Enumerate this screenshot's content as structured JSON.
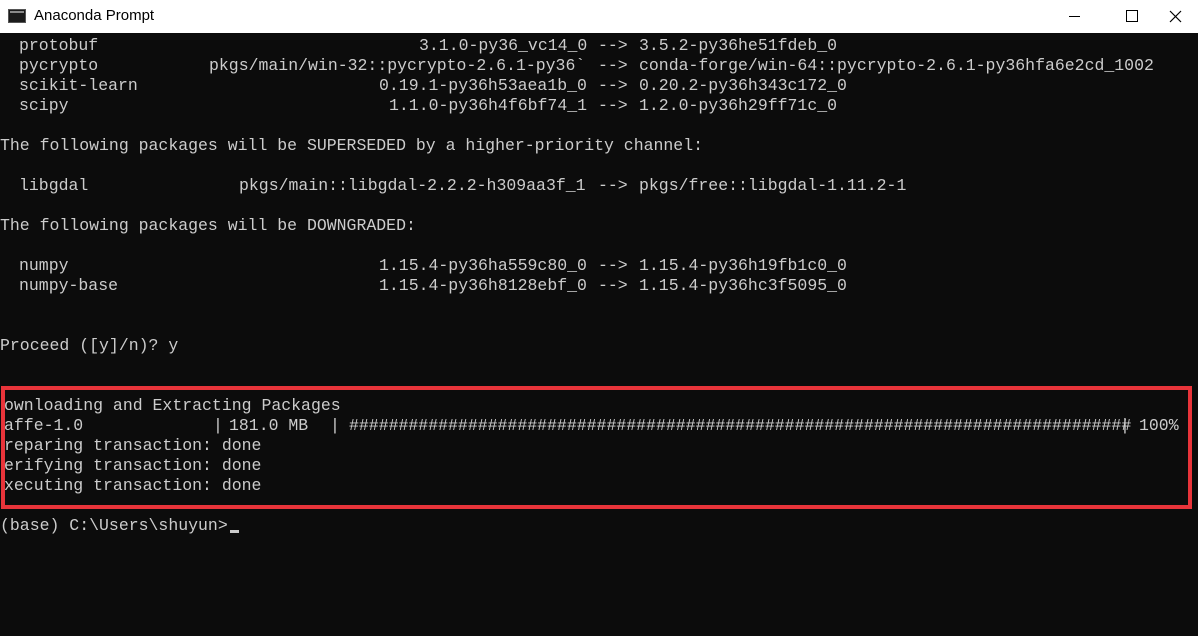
{
  "window": {
    "title": "Anaconda Prompt"
  },
  "console": {
    "pkg_protobuf": {
      "name": "protobuf",
      "from": "3.1.0-py36_vc14_0",
      "arrow": "-->",
      "to": "3.5.2-py36he51fdeb_0"
    },
    "pkg_pycrypto": {
      "name": "pycrypto",
      "from": "pkgs/main/win-32::pycrypto-2.6.1-py36`",
      "arrow": "-->",
      "to": "conda-forge/win-64::pycrypto-2.6.1-py36hfa6e2cd_1002"
    },
    "pkg_scikit": {
      "name": "scikit-learn",
      "from": "0.19.1-py36h53aea1b_0",
      "arrow": "-->",
      "to": "0.20.2-py36h343c172_0"
    },
    "pkg_scipy": {
      "name": "scipy",
      "from": "1.1.0-py36h4f6bf74_1",
      "arrow": "-->",
      "to": "1.2.0-py36h29ff71c_0"
    },
    "superseded_header": "The following packages will be SUPERSEDED by a higher-priority channel:",
    "pkg_libgdal": {
      "name": "libgdal",
      "from": "pkgs/main::libgdal-2.2.2-h309aa3f_1",
      "arrow": "-->",
      "to": "pkgs/free::libgdal-1.11.2-1"
    },
    "downgraded_header": "The following packages will be DOWNGRADED:",
    "pkg_numpy": {
      "name": "numpy",
      "from": "1.15.4-py36ha559c80_0",
      "arrow": "-->",
      "to": "1.15.4-py36h19fb1c0_0"
    },
    "pkg_numpy_base": {
      "name": "numpy-base",
      "from": "1.15.4-py36h8128ebf_0",
      "arrow": "-->",
      "to": "1.15.4-py36hc3f5095_0"
    },
    "proceed_prompt": "Proceed ([y]/n)? y",
    "download_header": "ownloading and Extracting Packages",
    "download": {
      "package": "affe-1.0",
      "sep1": "|",
      "size": "181.0 MB",
      "sep2": "|",
      "bar": "###############################################################################",
      "sep3": "|",
      "percent": "100%",
      "progress": 1.0
    },
    "preparing": "reparing transaction: done",
    "verifying": "erifying transaction: done",
    "executing": "xecuting transaction: done",
    "prompt": "(base) C:\\Users\\shuyun>"
  },
  "colors": {
    "background": "#0c0c0c",
    "text": "#cccccc",
    "highlight": "#e8343a"
  }
}
